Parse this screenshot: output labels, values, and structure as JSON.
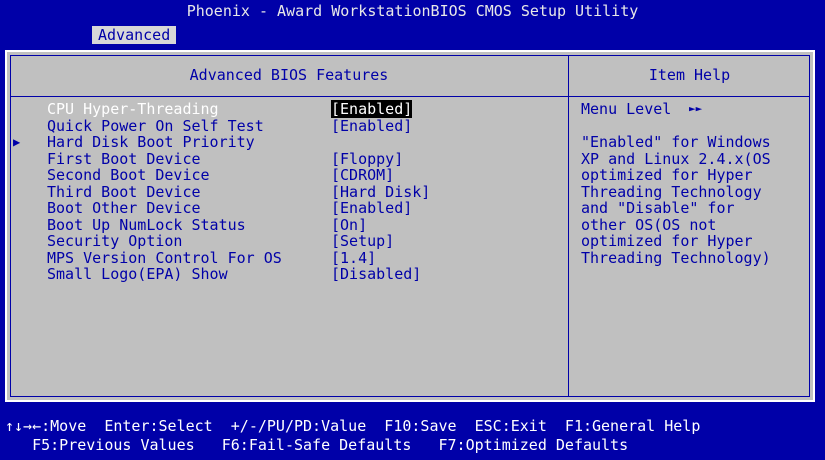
{
  "title": "Phoenix - Award WorkstationBIOS CMOS Setup Utility",
  "menu": {
    "active": "Advanced"
  },
  "panel": {
    "left_heading": "Advanced BIOS Features",
    "right_heading": "Item Help"
  },
  "settings": [
    {
      "label": "CPU Hyper-Threading",
      "value": "[Enabled]",
      "selected": true,
      "submenu": false
    },
    {
      "label": "Quick Power On Self Test",
      "value": "[Enabled]",
      "selected": false,
      "submenu": false
    },
    {
      "label": "Hard Disk Boot Priority",
      "value": "",
      "selected": false,
      "submenu": true
    },
    {
      "label": "First Boot Device",
      "value": "[Floppy]",
      "selected": false,
      "submenu": false
    },
    {
      "label": "Second Boot Device",
      "value": "[CDROM]",
      "selected": false,
      "submenu": false
    },
    {
      "label": "Third Boot Device",
      "value": "[Hard Disk]",
      "selected": false,
      "submenu": false
    },
    {
      "label": "Boot Other Device",
      "value": "[Enabled]",
      "selected": false,
      "submenu": false
    },
    {
      "label": "Boot Up NumLock Status",
      "value": "[On]",
      "selected": false,
      "submenu": false
    },
    {
      "label": "Security Option",
      "value": "[Setup]",
      "selected": false,
      "submenu": false
    },
    {
      "label": "MPS Version Control For OS",
      "value": "[1.4]",
      "selected": false,
      "submenu": false
    },
    {
      "label": "Small Logo(EPA) Show",
      "value": "[Disabled]",
      "selected": false,
      "submenu": false
    }
  ],
  "help": {
    "menu_level_label": "Menu Level",
    "menu_level_icon": "double-arrow",
    "text": "\"Enabled\" for Windows\nXP and Linux 2.4.x(OS\noptimized for Hyper\nThreading Technology\nand \"Disable\" for\nother OS(OS not\noptimized for Hyper\nThreading Technology)"
  },
  "footer": {
    "line1": "↑↓→←:Move  Enter:Select  +/-/PU/PD:Value  F10:Save  ESC:Exit  F1:General Help",
    "line2": "   F5:Previous Values   F6:Fail-Safe Defaults   F7:Optimized Defaults"
  },
  "colors": {
    "background": "#0000a8",
    "panel": "#c0c0c0",
    "text_blue": "#0000a8",
    "highlight": "#000000"
  }
}
